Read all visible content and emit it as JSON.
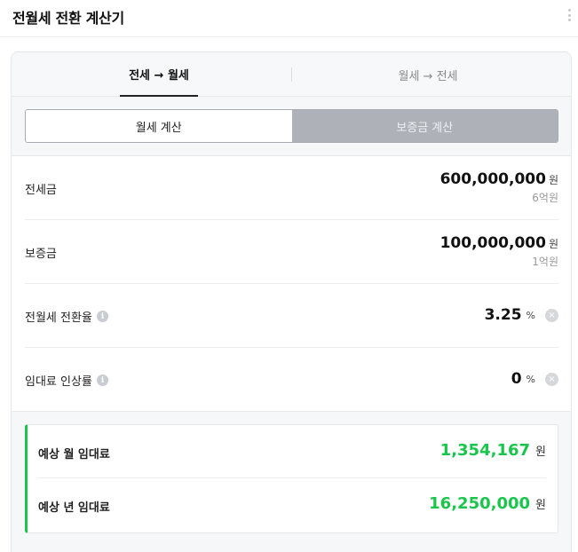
{
  "header": {
    "title": "전월세 전환 계산기",
    "more_icon": "more-vertical-icon"
  },
  "tabs": [
    {
      "label": "전세 → 월세",
      "active": true
    },
    {
      "label": "월세 → 전세",
      "active": false
    }
  ],
  "toggle": {
    "options": [
      {
        "label": "월세 계산",
        "selected": true
      },
      {
        "label": "보증금 계산",
        "selected": false
      }
    ]
  },
  "fields": {
    "jeonse": {
      "label": "전세금",
      "value": "600,000,000",
      "unit": "원",
      "sub": "6억원"
    },
    "deposit": {
      "label": "보증금",
      "value": "100,000,000",
      "unit": "원",
      "sub": "1억원"
    },
    "rate": {
      "label": "전월세 전환율",
      "value": "3.25",
      "unit": "%"
    },
    "increase": {
      "label": "임대료 인상률",
      "value": "0",
      "unit": "%"
    }
  },
  "result": {
    "monthly": {
      "label": "예상 월 임대료",
      "value": "1,354,167",
      "unit": "원"
    },
    "yearly": {
      "label": "예상 년 임대료",
      "value": "16,250,000",
      "unit": "원"
    }
  },
  "colors": {
    "accent_green": "#19c54a",
    "inactive_toggle": "#aeb1b7",
    "border": "#e4e6ea"
  },
  "icons": {
    "info": "info-icon",
    "clear": "clear-icon",
    "info_glyph": "i",
    "clear_glyph": "×"
  }
}
